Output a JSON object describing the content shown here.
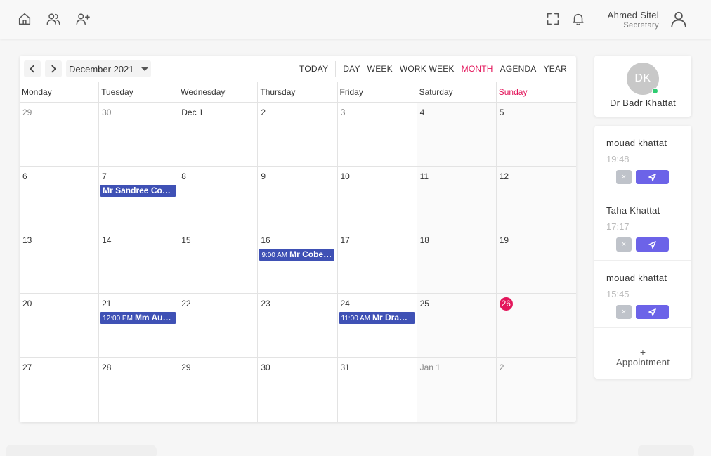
{
  "header": {
    "icons": [
      "home-icon",
      "users-icon",
      "add-user-icon",
      "fullscreen-icon",
      "bell-icon",
      "user-icon"
    ],
    "user_name": "Ahmed Sitel",
    "user_role": "Secretary"
  },
  "calendar": {
    "period_label": "December 2021",
    "today_label": "TODAY",
    "views": [
      "DAY",
      "WEEK",
      "WORK WEEK",
      "MONTH",
      "AGENDA",
      "YEAR"
    ],
    "active_view": "MONTH",
    "weekdays": [
      "Monday",
      "Tuesday",
      "Wednesday",
      "Thursday",
      "Friday",
      "Saturday",
      "Sunday"
    ],
    "weeks": [
      [
        {
          "d": "29",
          "other": true
        },
        {
          "d": "30",
          "other": true
        },
        {
          "d": "Dec 1"
        },
        {
          "d": "2"
        },
        {
          "d": "3"
        },
        {
          "d": "4"
        },
        {
          "d": "5"
        }
      ],
      [
        {
          "d": "6"
        },
        {
          "d": "7",
          "event": {
            "time": "",
            "title": "Mr Sandree Cons..."
          }
        },
        {
          "d": "8"
        },
        {
          "d": "9"
        },
        {
          "d": "10"
        },
        {
          "d": "11"
        },
        {
          "d": "12"
        }
      ],
      [
        {
          "d": "13"
        },
        {
          "d": "14"
        },
        {
          "d": "15"
        },
        {
          "d": "16",
          "event": {
            "time": "9:00 AM",
            "title": "Mr Cobee ..."
          }
        },
        {
          "d": "17"
        },
        {
          "d": "18"
        },
        {
          "d": "19"
        }
      ],
      [
        {
          "d": "20"
        },
        {
          "d": "21",
          "event": {
            "time": "12:00 PM",
            "title": "Mm Auro..."
          }
        },
        {
          "d": "22"
        },
        {
          "d": "23"
        },
        {
          "d": "24",
          "event": {
            "time": "11:00 AM",
            "title": "Mr Drak ..."
          }
        },
        {
          "d": "25"
        },
        {
          "d": "26",
          "today": true
        }
      ],
      [
        {
          "d": "27"
        },
        {
          "d": "28"
        },
        {
          "d": "29"
        },
        {
          "d": "30"
        },
        {
          "d": "31"
        },
        {
          "d": "Jan 1",
          "other": true
        },
        {
          "d": "2",
          "other": true
        }
      ]
    ]
  },
  "doctor": {
    "initials": "DK",
    "name": "Dr Badr Khattat"
  },
  "queue": [
    {
      "name": "mouad khattat",
      "time": "19:48"
    },
    {
      "name": "Taha Khattat",
      "time": "17:17"
    },
    {
      "name": "mouad khattat",
      "time": "15:45"
    }
  ],
  "appointment": {
    "plus": "+",
    "label": "Appointment"
  },
  "reject_glyph": "×",
  "colors": {
    "accent": "#e3165b",
    "event": "#3f51b5",
    "send": "#6c63e8",
    "online": "#2ecc71"
  }
}
